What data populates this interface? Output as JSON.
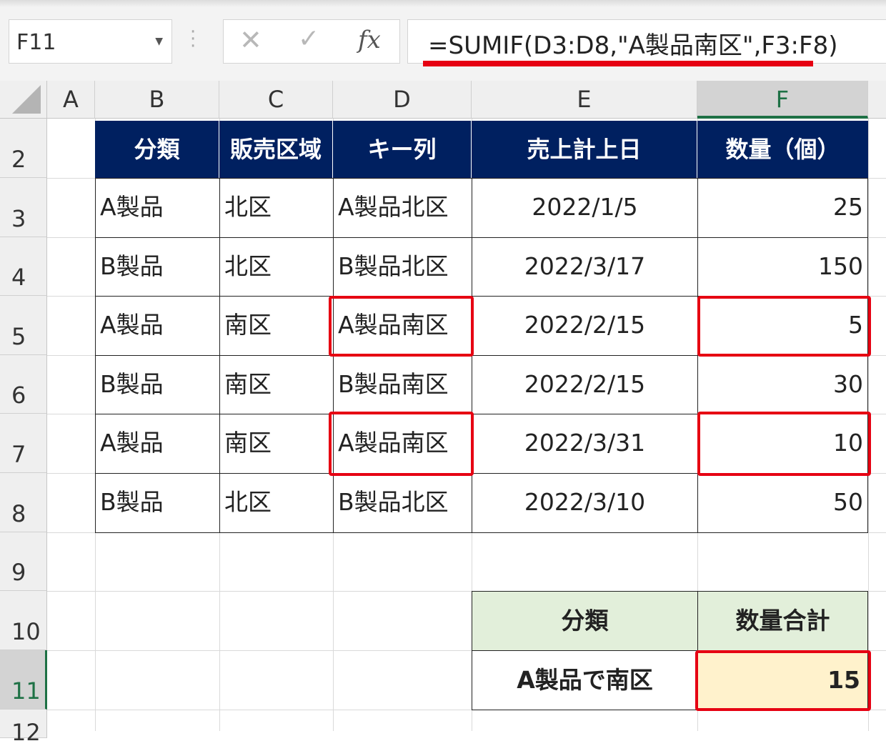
{
  "name_box": {
    "value": "F11"
  },
  "formula_bar": {
    "cancel_glyph": "✕",
    "enter_glyph": "✓",
    "insert_function_label": "fx",
    "formula": "=SUMIF(D3:D8,\"A製品南区\",F3:F8)"
  },
  "columns": [
    "A",
    "B",
    "C",
    "D",
    "E",
    "F"
  ],
  "selected_column": "F",
  "rows": [
    "2",
    "3",
    "4",
    "5",
    "6",
    "7",
    "8",
    "9",
    "10",
    "11",
    "12"
  ],
  "selected_row": "11",
  "table": {
    "headers": [
      "分類",
      "販売区域",
      "キー列",
      "売上計上日",
      "数量（個）"
    ],
    "data": [
      [
        "A製品",
        "北区",
        "A製品北区",
        "2022/1/5",
        "25"
      ],
      [
        "B製品",
        "北区",
        "B製品北区",
        "2022/3/17",
        "150"
      ],
      [
        "A製品",
        "南区",
        "A製品南区",
        "2022/2/15",
        "5"
      ],
      [
        "B製品",
        "南区",
        "B製品南区",
        "2022/2/15",
        "30"
      ],
      [
        "A製品",
        "南区",
        "A製品南区",
        "2022/3/31",
        "10"
      ],
      [
        "B製品",
        "北区",
        "B製品北区",
        "2022/3/10",
        "50"
      ]
    ]
  },
  "summary": {
    "headers": [
      "分類",
      "数量合計"
    ],
    "label": "A製品で南区",
    "value": "15"
  },
  "highlight_color": "#e60012",
  "header_fill_color": "#002060",
  "summary_header_fill": "#e2efda",
  "summary_value_fill": "#fff2cc"
}
